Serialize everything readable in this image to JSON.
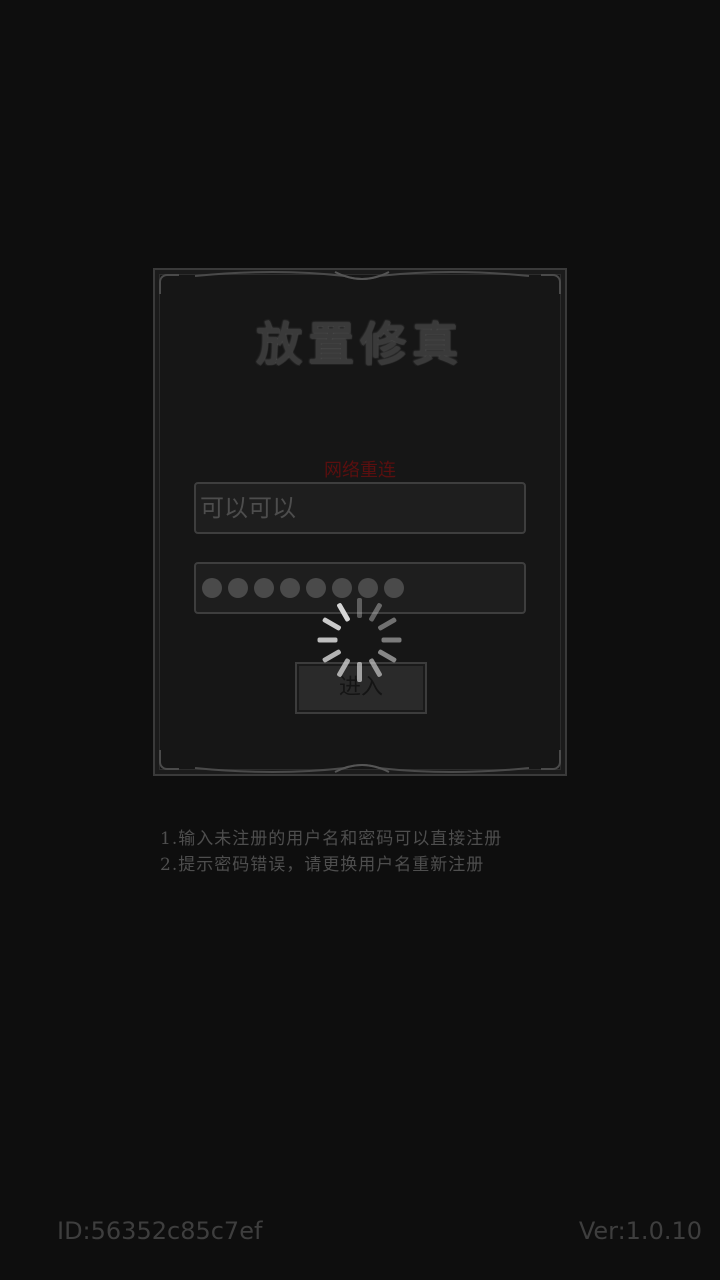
{
  "panel": {
    "title": "放置修真",
    "network_status": "网络重连",
    "username_value": "可以可以",
    "password_mask_count": 8,
    "enter_label": "进入"
  },
  "hints": {
    "line1": "1.输入未注册的用户名和密码可以直接注册",
    "line2": "2.提示密码错误，请更换用户名重新注册"
  },
  "footer": {
    "id_text": "ID:56352c85c7ef",
    "version_text": "Ver:1.0.10"
  },
  "loading": {
    "icon": "loading-spinner-icon",
    "visible": true
  },
  "colors": {
    "background": "#0e0e0e",
    "network_status": "#5a0f0f",
    "spinner": "#d6d6d6"
  }
}
